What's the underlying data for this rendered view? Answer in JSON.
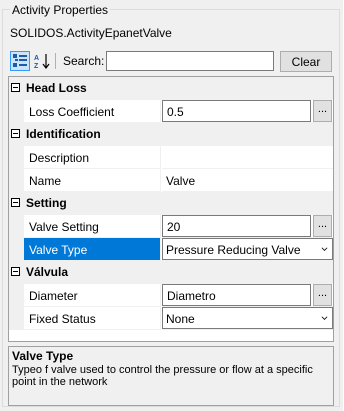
{
  "panel": {
    "title": "Activity Properties",
    "object_name": "SOLIDOS.ActivityEpanetValve"
  },
  "toolbar": {
    "categorized_icon": "categorized-view-icon",
    "alphabetical_icon": "alphabetical-sort-icon",
    "search_label": "Search:",
    "search_value": "",
    "clear_label": "Clear"
  },
  "grid": {
    "categories": [
      {
        "label": "Head Loss"
      },
      {
        "label": "Identification"
      },
      {
        "label": "Setting"
      },
      {
        "label": "Válvula"
      }
    ],
    "properties": [
      {
        "name": "Loss Coefficient",
        "value": "0.5",
        "editor": "ellipsis"
      },
      {
        "name": "Description",
        "value": "",
        "editor": "none"
      },
      {
        "name": "Name",
        "value": "Valve",
        "editor": "none"
      },
      {
        "name": "Valve Setting",
        "value": "20",
        "editor": "ellipsis"
      },
      {
        "name": "Valve Type",
        "value": "Pressure Reducing Valve",
        "editor": "dropdown",
        "selected": true
      },
      {
        "name": "Diameter",
        "value": "Diametro",
        "editor": "ellipsis"
      },
      {
        "name": "Fixed Status",
        "value": "None",
        "editor": "dropdown"
      }
    ],
    "ellipsis_label": "..."
  },
  "help": {
    "title": "Valve Type",
    "description": "Typeo f valve used to control the pressure or flow at a specific point in the network"
  },
  "colors": {
    "selection": "#0078d7",
    "background": "#f0f0f0",
    "grid_line": "#f0f0f0"
  }
}
